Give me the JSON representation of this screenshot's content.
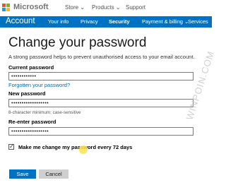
{
  "header": {
    "brand": "Microsoft",
    "store_label": "Store ⌄",
    "products_label": "Products ⌄",
    "support_label": "Support"
  },
  "account_nav": {
    "title": "Account",
    "items": [
      "Your info",
      "Privacy",
      "Security",
      "Payment & billing ⌄",
      "Services"
    ],
    "active": "Security"
  },
  "main": {
    "page_title": "Change your password",
    "intro": "A strong password helps to prevent unauthorised access to your email account.",
    "current_password_label": "Current password",
    "current_password_value": "••••••••••••",
    "forgot_link": "Forgotten your password?",
    "new_password_label": "New password",
    "new_password_value": "••••••••••••••••••",
    "new_password_hint": "8-character minimum; case-sensitive",
    "reenter_label": "Re-enter password",
    "reenter_value": "••••••••••••••••••",
    "checkbox_label": "Make me change my password every 72 days",
    "checkbox_checked": true,
    "save_label": "Save",
    "cancel_label": "Cancel"
  },
  "watermark": "WINPOIN.COM",
  "colors": {
    "accent": "#0072c6",
    "logo_red": "#f25022",
    "logo_green": "#7fba00",
    "logo_blue": "#00a4ef",
    "logo_yellow": "#ffb900"
  }
}
